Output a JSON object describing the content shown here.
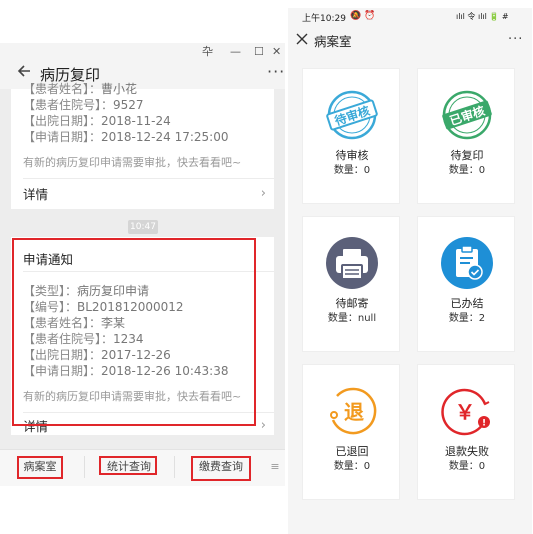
{
  "left_window": {
    "winbar": {
      "pin": "卆",
      "minimize": "—",
      "maximize": "☐",
      "close": "✕"
    },
    "nav": {
      "back_icon": "arrow-left-icon",
      "title": "病历复印",
      "more": "···"
    },
    "card1": {
      "lines": [
        {
          "label": "【患者姓名】：",
          "value": "曹小花"
        },
        {
          "label": "【患者住院号】：",
          "value": "9527"
        },
        {
          "label": "【出院日期】：",
          "value": "2018-11-24"
        },
        {
          "label": "【申请日期】：",
          "value": "2018-12-24 17:25:00"
        }
      ],
      "hint": "有新的病历复印申请需要审批，快去看看吧~",
      "detail": "详情"
    },
    "time": "10:47",
    "card2": {
      "title": "申请通知",
      "lines": [
        {
          "label": "【类型】：",
          "value": "病历复印申请"
        },
        {
          "label": "【编号】：",
          "value": "BL201812000012"
        },
        {
          "label": "【患者姓名】：",
          "value": "李某"
        },
        {
          "label": "【患者住院号】：",
          "value": "1234"
        },
        {
          "label": "【出院日期】：",
          "value": "2017-12-26"
        },
        {
          "label": "【申请日期】：",
          "value": "2018-12-26 10:43:38"
        }
      ],
      "hint": "有新的病历复印申请需要审批，快去看看吧~",
      "detail": "详情"
    },
    "bottom_tabs": [
      "病案室",
      "统计查询",
      "缴费查询"
    ],
    "keyboard_icon": "≡",
    "highlight_color": "#e0262a"
  },
  "right_window": {
    "status": {
      "time": "上午10:29",
      "indicators": "🔕 ⏰",
      "right": "ılıl 令 ılıl 🔋 #"
    },
    "header": {
      "close_icon": "close-icon",
      "title": "病案室",
      "more": "···"
    },
    "tiles": [
      {
        "icon": "pending-review-stamp-icon",
        "stamp_text": "待审核",
        "name": "待审核",
        "count": "数量：0",
        "color": "#3aa9d8"
      },
      {
        "icon": "reviewed-stamp-icon",
        "stamp_text": "已审核",
        "name": "待复印",
        "count": "数量：0",
        "color": "#3aa86a"
      },
      {
        "icon": "printer-icon",
        "name": "待邮寄",
        "count": "数量：null",
        "color": "#5b6079"
      },
      {
        "icon": "clipboard-check-icon",
        "name": "已办结",
        "count": "数量：2",
        "color": "#1e8fd6"
      },
      {
        "icon": "return-icon",
        "stamp_text": "退",
        "name": "已退回",
        "count": "数量：0",
        "color": "#f29a1f"
      },
      {
        "icon": "refund-failed-icon",
        "stamp_text": "￥",
        "name": "退款失败",
        "count": "数量：0",
        "color": "#e0262a"
      }
    ]
  }
}
